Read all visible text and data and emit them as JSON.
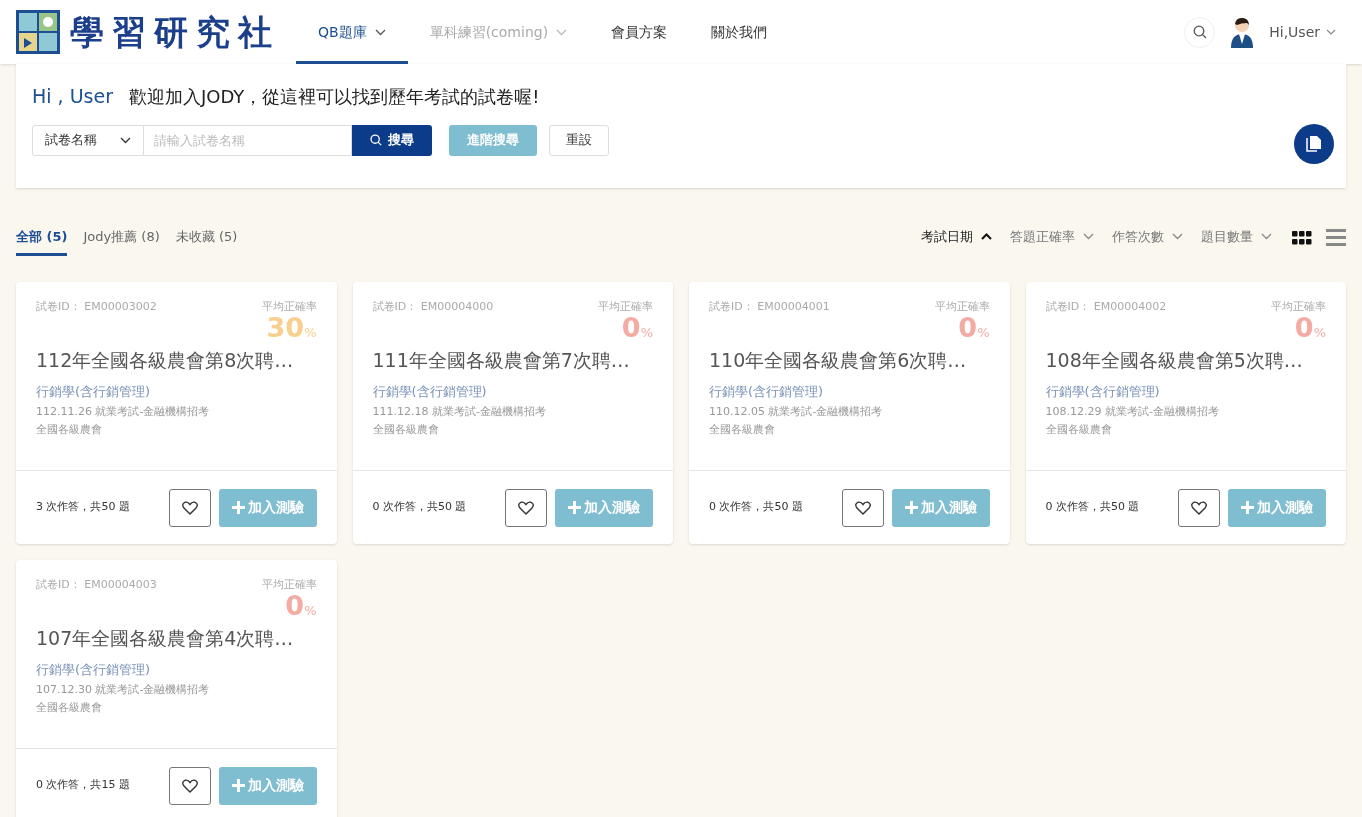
{
  "header": {
    "logo_text": "學習研究社",
    "nav": [
      {
        "label": "QB題庫",
        "selected": true,
        "disabled": false,
        "dropdown": true
      },
      {
        "label": "單科練習(coming)",
        "selected": false,
        "disabled": true,
        "dropdown": true
      },
      {
        "label": "會員方案",
        "selected": false,
        "disabled": false,
        "dropdown": false
      },
      {
        "label": "關於我們",
        "selected": false,
        "disabled": false,
        "dropdown": false
      }
    ],
    "user": "Hi,User"
  },
  "welcome": {
    "greeting": "Hi , User",
    "message": "歡迎加入JODY，從這裡可以找到歷年考試的試卷喔!"
  },
  "search": {
    "field_select": "試卷名稱",
    "placeholder": "請輸入試卷名稱",
    "search_button": "搜尋",
    "advanced_button": "進階搜尋",
    "reset_button": "重設"
  },
  "tabs": [
    {
      "label": "全部 (5)",
      "selected": true
    },
    {
      "label": "Jody推薦 (8)",
      "selected": false
    },
    {
      "label": "未收藏 (5)",
      "selected": false
    }
  ],
  "sorts": [
    {
      "label": "考試日期",
      "selected": true
    },
    {
      "label": "答題正確率",
      "selected": false
    },
    {
      "label": "作答次數",
      "selected": false
    },
    {
      "label": "題目數量",
      "selected": false
    }
  ],
  "views": [
    {
      "kind": "grid",
      "selected": true
    },
    {
      "kind": "list",
      "selected": false
    }
  ],
  "cards": [
    {
      "id": "試卷ID： EM00003002",
      "rate_label": "平均正確率",
      "rate": "30",
      "unit": "%",
      "color": "#f8cf8f",
      "title": "112年全國各級農會第8次聘…",
      "subject": "行銷學(含行銷管理)",
      "date_type": "112.11.26 就業考試-金融機構招考",
      "org": "全國各級農會",
      "stats": "3 次作答，共50 題",
      "favorited": false,
      "add_button": "加入測驗"
    },
    {
      "id": "試卷ID： EM00004000",
      "rate_label": "平均正確率",
      "rate": "0",
      "unit": "%",
      "color": "#f4aba3",
      "title": "111年全國各級農會第7次聘…",
      "subject": "行銷學(含行銷管理)",
      "date_type": "111.12.18 就業考試-金融機構招考",
      "org": "全國各級農會",
      "stats": "0 次作答，共50 題",
      "favorited": false,
      "add_button": "加入測驗"
    },
    {
      "id": "試卷ID： EM00004001",
      "rate_label": "平均正確率",
      "rate": "0",
      "unit": "%",
      "color": "#f4aba3",
      "title": "110年全國各級農會第6次聘…",
      "subject": "行銷學(含行銷管理)",
      "date_type": "110.12.05 就業考試-金融機構招考",
      "org": "全國各級農會",
      "stats": "0 次作答，共50 題",
      "favorited": false,
      "add_button": "加入測驗"
    },
    {
      "id": "試卷ID： EM00004002",
      "rate_label": "平均正確率",
      "rate": "0",
      "unit": "%",
      "color": "#f4aba3",
      "title": "108年全國各級農會第5次聘…",
      "subject": "行銷學(含行銷管理)",
      "date_type": "108.12.29 就業考試-金融機構招考",
      "org": "全國各級農會",
      "stats": "0 次作答，共50 題",
      "favorited": false,
      "add_button": "加入測驗"
    },
    {
      "id": "試卷ID： EM00004003",
      "rate_label": "平均正確率",
      "rate": "0",
      "unit": "%",
      "color": "#f4aba3",
      "title": "107年全國各級農會第4次聘…",
      "subject": "行銷學(含行銷管理)",
      "date_type": "107.12.30 就業考試-金融機構招考",
      "org": "全國各級農會",
      "stats": "0 次作答，共15 題",
      "favorited": false,
      "add_button": "加入測驗"
    }
  ]
}
